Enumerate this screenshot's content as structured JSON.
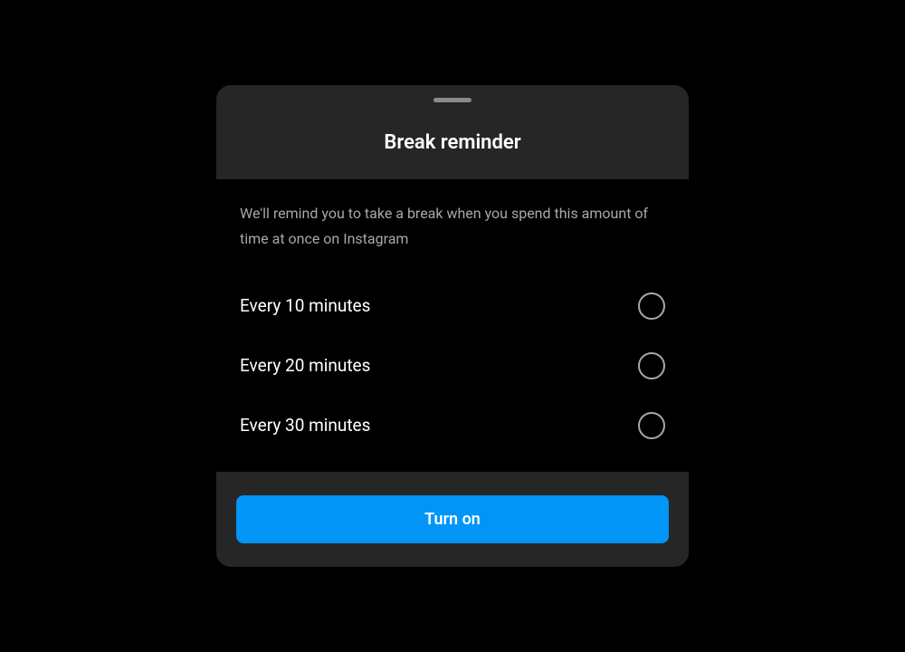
{
  "header": {
    "title": "Break reminder"
  },
  "description": "We'll remind you to take a break when you spend this amount of time at once on Instagram",
  "options": [
    {
      "label": "Every 10 minutes",
      "selected": false
    },
    {
      "label": "Every 20 minutes",
      "selected": false
    },
    {
      "label": "Every 30 minutes",
      "selected": false
    }
  ],
  "footer": {
    "button_label": "Turn on"
  },
  "colors": {
    "accent": "#0095f6",
    "surface_dark": "#262626",
    "background": "#000000",
    "text_primary": "#ffffff",
    "text_secondary": "#a8a8a8"
  }
}
